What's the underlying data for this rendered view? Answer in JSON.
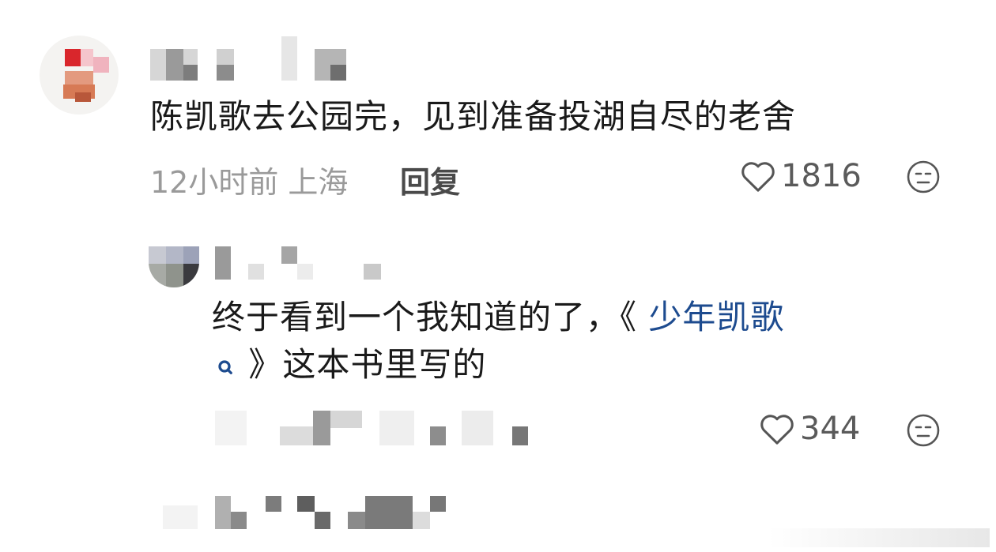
{
  "comments": [
    {
      "text": "陈凯歌去公园完，见到准备投湖自尽的老舍",
      "time_location": "12小时前 上海",
      "reply_label": "回复",
      "likes": "1816"
    },
    {
      "text_before_link": "终于看到一个我知道的了，《",
      "link_text": " 少年凯歌",
      "text_after_link": " 》这本书里写的",
      "likes": "344"
    }
  ],
  "icons": {
    "like": "heart-outline-icon",
    "dislike": "neutral-face-icon",
    "search": "search-icon"
  },
  "colors": {
    "link": "#1d4b8f",
    "meta": "#9a9a9a"
  }
}
